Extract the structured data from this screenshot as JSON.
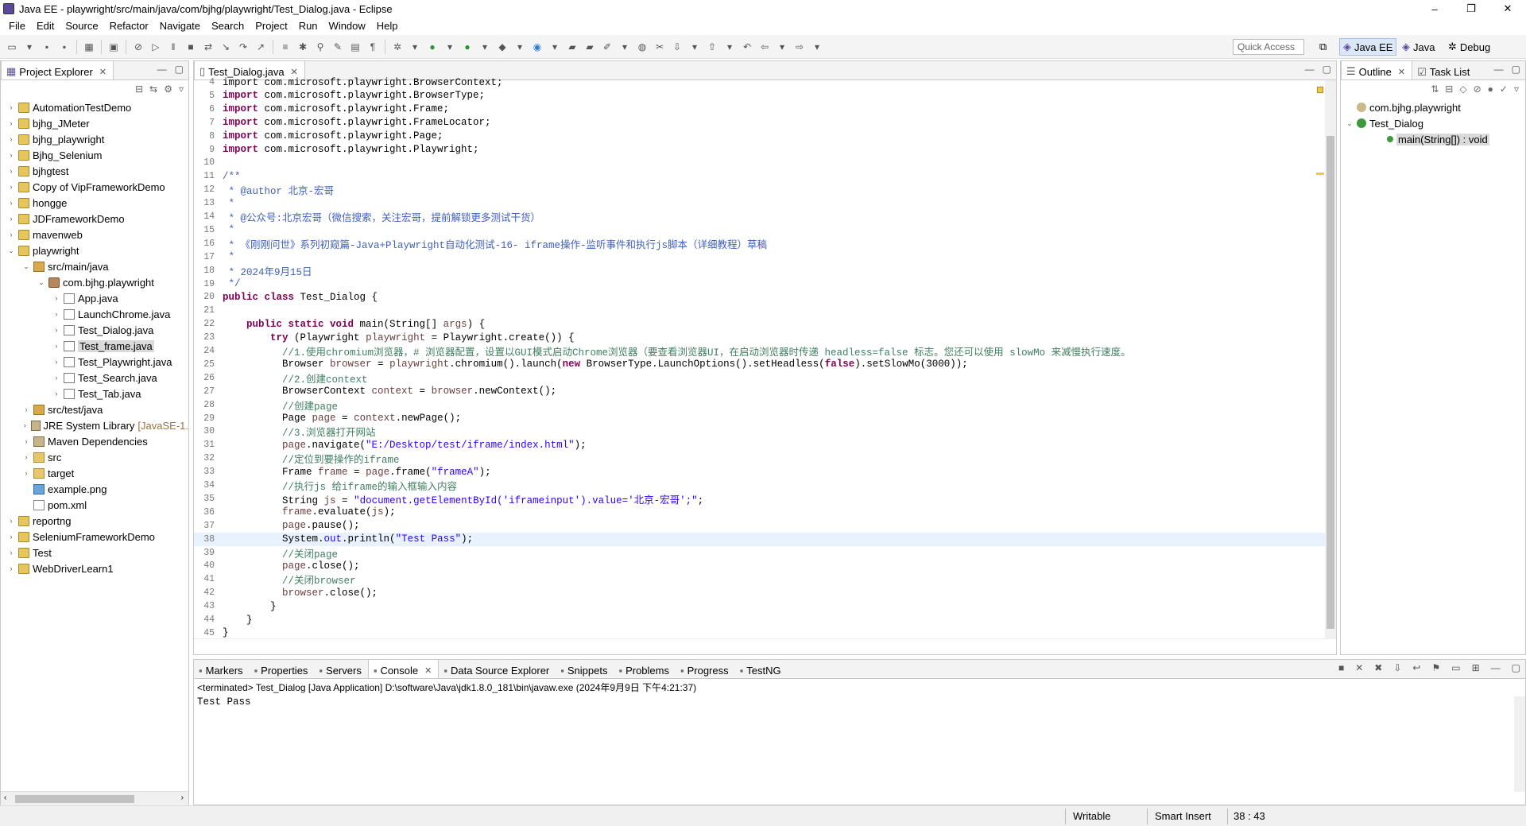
{
  "window": {
    "title": "Java EE - playwright/src/main/java/com/bjhg/playwright/Test_Dialog.java - Eclipse",
    "controls": [
      "–",
      "❐",
      "✕"
    ]
  },
  "menu": [
    "File",
    "Edit",
    "Source",
    "Refactor",
    "Navigate",
    "Search",
    "Project",
    "Run",
    "Window",
    "Help"
  ],
  "toolbar": {
    "quick_access_placeholder": "Quick Access",
    "perspectives": [
      "Java EE",
      "Java",
      "Debug"
    ]
  },
  "project_explorer": {
    "tab": "Project Explorer",
    "items": [
      {
        "label": "AutomationTestDemo",
        "depth": 0,
        "icon": "project",
        "arrow": "›"
      },
      {
        "label": "bjhg_JMeter",
        "depth": 0,
        "icon": "project",
        "arrow": "›"
      },
      {
        "label": "bjhg_playwright",
        "depth": 0,
        "icon": "project",
        "arrow": "›"
      },
      {
        "label": "Bjhg_Selenium",
        "depth": 0,
        "icon": "project",
        "arrow": "›"
      },
      {
        "label": "bjhgtest",
        "depth": 0,
        "icon": "project",
        "arrow": "›"
      },
      {
        "label": "Copy of VipFrameworkDemo",
        "depth": 0,
        "icon": "project",
        "arrow": "›"
      },
      {
        "label": "hongge",
        "depth": 0,
        "icon": "project",
        "arrow": "›"
      },
      {
        "label": "JDFrameworkDemo",
        "depth": 0,
        "icon": "project",
        "arrow": "›"
      },
      {
        "label": "mavenweb",
        "depth": 0,
        "icon": "project",
        "arrow": "›"
      },
      {
        "label": "playwright",
        "depth": 0,
        "icon": "project",
        "arrow": "⌄"
      },
      {
        "label": "src/main/java",
        "depth": 1,
        "icon": "srcfolder",
        "arrow": "⌄"
      },
      {
        "label": "com.bjhg.playwright",
        "depth": 2,
        "icon": "package",
        "arrow": "⌄"
      },
      {
        "label": "App.java",
        "depth": 3,
        "icon": "java",
        "arrow": "›"
      },
      {
        "label": "LaunchChrome.java",
        "depth": 3,
        "icon": "java",
        "arrow": "›"
      },
      {
        "label": "Test_Dialog.java",
        "depth": 3,
        "icon": "java",
        "arrow": "›"
      },
      {
        "label": "Test_frame.java",
        "depth": 3,
        "icon": "java",
        "arrow": "›",
        "selected": true
      },
      {
        "label": "Test_Playwright.java",
        "depth": 3,
        "icon": "java",
        "arrow": "›"
      },
      {
        "label": "Test_Search.java",
        "depth": 3,
        "icon": "java",
        "arrow": "›"
      },
      {
        "label": "Test_Tab.java",
        "depth": 3,
        "icon": "java",
        "arrow": "›"
      },
      {
        "label": "src/test/java",
        "depth": 1,
        "icon": "srcfolder",
        "arrow": "›"
      },
      {
        "label": "JRE System Library",
        "suffix": "[JavaSE-1.",
        "depth": 1,
        "icon": "library",
        "arrow": "›"
      },
      {
        "label": "Maven Dependencies",
        "depth": 1,
        "icon": "library",
        "arrow": "›"
      },
      {
        "label": "src",
        "depth": 1,
        "icon": "folder",
        "arrow": "›"
      },
      {
        "label": "target",
        "depth": 1,
        "icon": "folder",
        "arrow": "›"
      },
      {
        "label": "example.png",
        "depth": 1,
        "icon": "image",
        "arrow": ""
      },
      {
        "label": "pom.xml",
        "depth": 1,
        "icon": "xml",
        "arrow": ""
      },
      {
        "label": "reportng",
        "depth": 0,
        "icon": "project",
        "arrow": "›"
      },
      {
        "label": "SeleniumFrameworkDemo",
        "depth": 0,
        "icon": "project",
        "arrow": "›"
      },
      {
        "label": "Test",
        "depth": 0,
        "icon": "project",
        "arrow": "›"
      },
      {
        "label": "WebDriverLearn1",
        "depth": 0,
        "icon": "project",
        "arrow": "›"
      }
    ]
  },
  "editor": {
    "tab": "Test_Dialog.java",
    "lines": [
      {
        "n": "4",
        "segs": [
          {
            "t": "import com.microsoft.playwright.BrowserContext;",
            "c": ""
          }
        ]
      },
      {
        "n": "5",
        "segs": [
          {
            "t": "import",
            "c": "kw"
          },
          {
            "t": " com.microsoft.playwright.BrowserType;",
            "c": ""
          }
        ]
      },
      {
        "n": "6",
        "segs": [
          {
            "t": "import",
            "c": "kw"
          },
          {
            "t": " com.microsoft.playwright.Frame;",
            "c": ""
          }
        ]
      },
      {
        "n": "7",
        "segs": [
          {
            "t": "import",
            "c": "kw"
          },
          {
            "t": " com.microsoft.playwright.FrameLocator;",
            "c": ""
          }
        ]
      },
      {
        "n": "8",
        "segs": [
          {
            "t": "import",
            "c": "kw"
          },
          {
            "t": " com.microsoft.playwright.Page;",
            "c": ""
          }
        ]
      },
      {
        "n": "9",
        "segs": [
          {
            "t": "import",
            "c": "kw"
          },
          {
            "t": " com.microsoft.playwright.Playwright;",
            "c": ""
          }
        ]
      },
      {
        "n": "10",
        "segs": []
      },
      {
        "n": "11",
        "segs": [
          {
            "t": "/**",
            "c": "jd"
          }
        ]
      },
      {
        "n": "12",
        "segs": [
          {
            "t": " * @author 北京-宏哥",
            "c": "jd"
          }
        ]
      },
      {
        "n": "13",
        "segs": [
          {
            "t": " *",
            "c": "jd"
          }
        ]
      },
      {
        "n": "14",
        "segs": [
          {
            "t": " * @公众号:北京宏哥（微信搜索，关注宏哥，提前解锁更多测试干货）",
            "c": "jd"
          }
        ]
      },
      {
        "n": "15",
        "segs": [
          {
            "t": " *",
            "c": "jd"
          }
        ]
      },
      {
        "n": "16",
        "segs": [
          {
            "t": " * 《刚刚问世》系列初窥篇-Java+Playwright自动化测试-16- iframe操作-监听事件和执行js脚本（详细教程）草稿",
            "c": "jd"
          }
        ]
      },
      {
        "n": "17",
        "segs": [
          {
            "t": " *",
            "c": "jd"
          }
        ]
      },
      {
        "n": "18",
        "segs": [
          {
            "t": " * 2024年9月15日",
            "c": "jd"
          }
        ]
      },
      {
        "n": "19",
        "segs": [
          {
            "t": " */",
            "c": "jd"
          }
        ]
      },
      {
        "n": "20",
        "segs": [
          {
            "t": "public class",
            "c": "kw"
          },
          {
            "t": " Test_Dialog {",
            "c": ""
          }
        ]
      },
      {
        "n": "21",
        "segs": []
      },
      {
        "n": "22",
        "segs": [
          {
            "t": "    ",
            "c": ""
          },
          {
            "t": "public static void",
            "c": "kw"
          },
          {
            "t": " main(String[] ",
            "c": ""
          },
          {
            "t": "args",
            "c": "fld"
          },
          {
            "t": ") {",
            "c": ""
          }
        ]
      },
      {
        "n": "23",
        "segs": [
          {
            "t": "        ",
            "c": ""
          },
          {
            "t": "try",
            "c": "kw"
          },
          {
            "t": " (Playwright ",
            "c": ""
          },
          {
            "t": "playwright",
            "c": "fld"
          },
          {
            "t": " = Playwright.create()) {",
            "c": ""
          }
        ]
      },
      {
        "n": "24",
        "segs": [
          {
            "t": "          //1.使用chromium浏览器，# 浏览器配置，设置以GUI模式启动Chrome浏览器（要查看浏览器UI，在启动浏览器时传递 headless=false 标志。您还可以使用 slowMo 来减慢执行速度。",
            "c": "cm"
          }
        ]
      },
      {
        "n": "25",
        "segs": [
          {
            "t": "          Browser ",
            "c": ""
          },
          {
            "t": "browser",
            "c": "fld"
          },
          {
            "t": " = ",
            "c": ""
          },
          {
            "t": "playwright",
            "c": "fld"
          },
          {
            "t": ".chromium().launch(",
            "c": ""
          },
          {
            "t": "new",
            "c": "kw"
          },
          {
            "t": " BrowserType.LaunchOptions().setHeadless(",
            "c": ""
          },
          {
            "t": "false",
            "c": "kw"
          },
          {
            "t": ").setSlowMo(3000));",
            "c": ""
          }
        ]
      },
      {
        "n": "26",
        "segs": [
          {
            "t": "          //2.创建context",
            "c": "cm"
          }
        ]
      },
      {
        "n": "27",
        "segs": [
          {
            "t": "          BrowserContext ",
            "c": ""
          },
          {
            "t": "context",
            "c": "fld"
          },
          {
            "t": " = ",
            "c": ""
          },
          {
            "t": "browser",
            "c": "fld"
          },
          {
            "t": ".newContext();",
            "c": ""
          }
        ]
      },
      {
        "n": "28",
        "segs": [
          {
            "t": "          //创建page",
            "c": "cm"
          }
        ]
      },
      {
        "n": "29",
        "segs": [
          {
            "t": "          Page ",
            "c": ""
          },
          {
            "t": "page",
            "c": "fld"
          },
          {
            "t": " = ",
            "c": ""
          },
          {
            "t": "context",
            "c": "fld"
          },
          {
            "t": ".newPage();",
            "c": ""
          }
        ]
      },
      {
        "n": "30",
        "segs": [
          {
            "t": "          //3.浏览器打开网站",
            "c": "cm"
          }
        ]
      },
      {
        "n": "31",
        "segs": [
          {
            "t": "          ",
            "c": ""
          },
          {
            "t": "page",
            "c": "fld"
          },
          {
            "t": ".navigate(",
            "c": ""
          },
          {
            "t": "\"E:/Desktop/test/iframe/index.html\"",
            "c": "str"
          },
          {
            "t": ");",
            "c": ""
          }
        ]
      },
      {
        "n": "32",
        "segs": [
          {
            "t": "          //定位到要操作的iframe",
            "c": "cm"
          }
        ]
      },
      {
        "n": "33",
        "segs": [
          {
            "t": "          Frame ",
            "c": ""
          },
          {
            "t": "frame",
            "c": "fld"
          },
          {
            "t": " = ",
            "c": ""
          },
          {
            "t": "page",
            "c": "fld"
          },
          {
            "t": ".frame(",
            "c": ""
          },
          {
            "t": "\"frameA\"",
            "c": "str"
          },
          {
            "t": ");",
            "c": ""
          }
        ]
      },
      {
        "n": "34",
        "segs": [
          {
            "t": "          //执行js 给iframe的输入框输入内容",
            "c": "cm"
          }
        ]
      },
      {
        "n": "35",
        "segs": [
          {
            "t": "          String ",
            "c": ""
          },
          {
            "t": "js",
            "c": "fld"
          },
          {
            "t": " = ",
            "c": ""
          },
          {
            "t": "\"document.getElementById('iframeinput').value='北京-宏哥';\"",
            "c": "str"
          },
          {
            "t": ";",
            "c": ""
          }
        ]
      },
      {
        "n": "36",
        "segs": [
          {
            "t": "          ",
            "c": ""
          },
          {
            "t": "frame",
            "c": "fld"
          },
          {
            "t": ".evaluate(",
            "c": ""
          },
          {
            "t": "js",
            "c": "fld"
          },
          {
            "t": ");",
            "c": ""
          }
        ]
      },
      {
        "n": "37",
        "segs": [
          {
            "t": "          ",
            "c": ""
          },
          {
            "t": "page",
            "c": "fld"
          },
          {
            "t": ".pause();",
            "c": ""
          }
        ]
      },
      {
        "n": "38",
        "segs": [
          {
            "t": "          System.",
            "c": ""
          },
          {
            "t": "out",
            "c": "str"
          },
          {
            "t": ".println(",
            "c": ""
          },
          {
            "t": "\"Test Pass\"",
            "c": "str"
          },
          {
            "t": ");",
            "c": ""
          }
        ],
        "current": true
      },
      {
        "n": "39",
        "segs": [
          {
            "t": "          //关闭page",
            "c": "cm"
          }
        ]
      },
      {
        "n": "40",
        "segs": [
          {
            "t": "          ",
            "c": ""
          },
          {
            "t": "page",
            "c": "fld"
          },
          {
            "t": ".close();",
            "c": ""
          }
        ]
      },
      {
        "n": "41",
        "segs": [
          {
            "t": "          //关闭browser",
            "c": "cm"
          }
        ]
      },
      {
        "n": "42",
        "segs": [
          {
            "t": "          ",
            "c": ""
          },
          {
            "t": "browser",
            "c": "fld"
          },
          {
            "t": ".close();",
            "c": ""
          }
        ]
      },
      {
        "n": "43",
        "segs": [
          {
            "t": "        }",
            "c": ""
          }
        ]
      },
      {
        "n": "44",
        "segs": [
          {
            "t": "    }",
            "c": ""
          }
        ]
      },
      {
        "n": "45",
        "segs": [
          {
            "t": "}",
            "c": ""
          }
        ]
      }
    ]
  },
  "outline": {
    "tabs": [
      "Outline",
      "Task List"
    ],
    "items": [
      {
        "label": "com.bjhg.playwright",
        "depth": 0,
        "arrow": ""
      },
      {
        "label": "Test_Dialog",
        "depth": 0,
        "arrow": "⌄"
      },
      {
        "label": "main(String[]) : void",
        "depth": 1,
        "arrow": "",
        "selected": true
      }
    ]
  },
  "bottom_panel": {
    "tabs": [
      {
        "label": "Markers",
        "active": false
      },
      {
        "label": "Properties",
        "active": false
      },
      {
        "label": "Servers",
        "active": false
      },
      {
        "label": "Console",
        "active": true
      },
      {
        "label": "Data Source Explorer",
        "active": false
      },
      {
        "label": "Snippets",
        "active": false
      },
      {
        "label": "Problems",
        "active": false
      },
      {
        "label": "Progress",
        "active": false
      },
      {
        "label": "TestNG",
        "active": false
      }
    ],
    "terminated_line": "<terminated> Test_Dialog [Java Application] D:\\software\\Java\\jdk1.8.0_181\\bin\\javaw.exe (2024年9月9日 下午4:21:37)",
    "output": "Test Pass"
  },
  "statusbar": {
    "writable": "Writable",
    "insert_mode": "Smart Insert",
    "position": "38 : 43"
  }
}
